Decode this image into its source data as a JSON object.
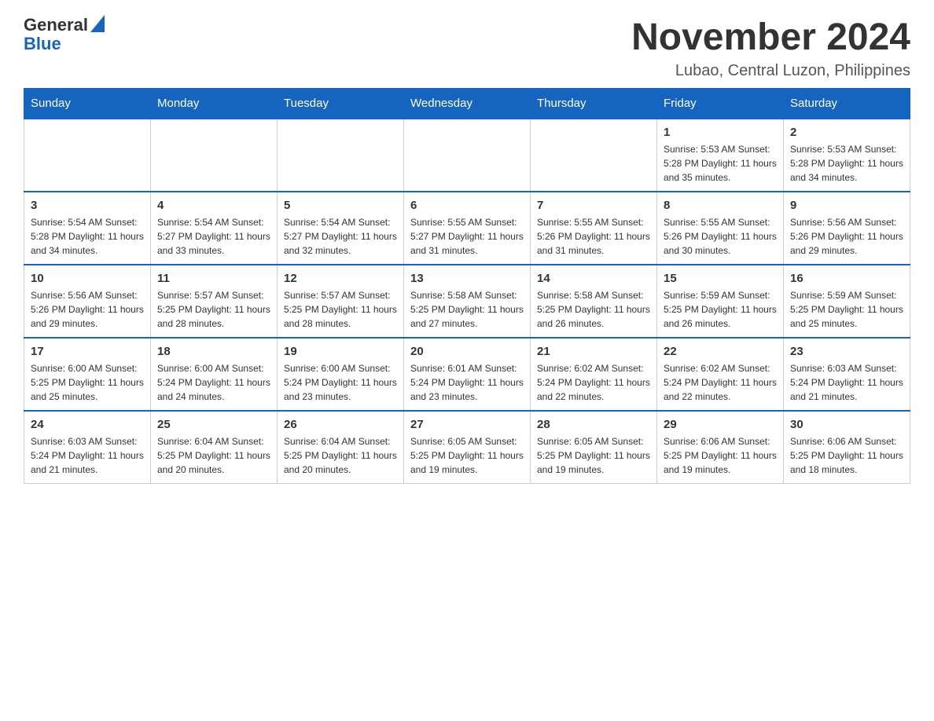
{
  "header": {
    "logo_general": "General",
    "logo_blue": "Blue",
    "title": "November 2024",
    "subtitle": "Lubao, Central Luzon, Philippines"
  },
  "calendar": {
    "days_of_week": [
      "Sunday",
      "Monday",
      "Tuesday",
      "Wednesday",
      "Thursday",
      "Friday",
      "Saturday"
    ],
    "weeks": [
      [
        {
          "day": "",
          "info": ""
        },
        {
          "day": "",
          "info": ""
        },
        {
          "day": "",
          "info": ""
        },
        {
          "day": "",
          "info": ""
        },
        {
          "day": "",
          "info": ""
        },
        {
          "day": "1",
          "info": "Sunrise: 5:53 AM\nSunset: 5:28 PM\nDaylight: 11 hours and 35 minutes."
        },
        {
          "day": "2",
          "info": "Sunrise: 5:53 AM\nSunset: 5:28 PM\nDaylight: 11 hours and 34 minutes."
        }
      ],
      [
        {
          "day": "3",
          "info": "Sunrise: 5:54 AM\nSunset: 5:28 PM\nDaylight: 11 hours and 34 minutes."
        },
        {
          "day": "4",
          "info": "Sunrise: 5:54 AM\nSunset: 5:27 PM\nDaylight: 11 hours and 33 minutes."
        },
        {
          "day": "5",
          "info": "Sunrise: 5:54 AM\nSunset: 5:27 PM\nDaylight: 11 hours and 32 minutes."
        },
        {
          "day": "6",
          "info": "Sunrise: 5:55 AM\nSunset: 5:27 PM\nDaylight: 11 hours and 31 minutes."
        },
        {
          "day": "7",
          "info": "Sunrise: 5:55 AM\nSunset: 5:26 PM\nDaylight: 11 hours and 31 minutes."
        },
        {
          "day": "8",
          "info": "Sunrise: 5:55 AM\nSunset: 5:26 PM\nDaylight: 11 hours and 30 minutes."
        },
        {
          "day": "9",
          "info": "Sunrise: 5:56 AM\nSunset: 5:26 PM\nDaylight: 11 hours and 29 minutes."
        }
      ],
      [
        {
          "day": "10",
          "info": "Sunrise: 5:56 AM\nSunset: 5:26 PM\nDaylight: 11 hours and 29 minutes."
        },
        {
          "day": "11",
          "info": "Sunrise: 5:57 AM\nSunset: 5:25 PM\nDaylight: 11 hours and 28 minutes."
        },
        {
          "day": "12",
          "info": "Sunrise: 5:57 AM\nSunset: 5:25 PM\nDaylight: 11 hours and 28 minutes."
        },
        {
          "day": "13",
          "info": "Sunrise: 5:58 AM\nSunset: 5:25 PM\nDaylight: 11 hours and 27 minutes."
        },
        {
          "day": "14",
          "info": "Sunrise: 5:58 AM\nSunset: 5:25 PM\nDaylight: 11 hours and 26 minutes."
        },
        {
          "day": "15",
          "info": "Sunrise: 5:59 AM\nSunset: 5:25 PM\nDaylight: 11 hours and 26 minutes."
        },
        {
          "day": "16",
          "info": "Sunrise: 5:59 AM\nSunset: 5:25 PM\nDaylight: 11 hours and 25 minutes."
        }
      ],
      [
        {
          "day": "17",
          "info": "Sunrise: 6:00 AM\nSunset: 5:25 PM\nDaylight: 11 hours and 25 minutes."
        },
        {
          "day": "18",
          "info": "Sunrise: 6:00 AM\nSunset: 5:24 PM\nDaylight: 11 hours and 24 minutes."
        },
        {
          "day": "19",
          "info": "Sunrise: 6:00 AM\nSunset: 5:24 PM\nDaylight: 11 hours and 23 minutes."
        },
        {
          "day": "20",
          "info": "Sunrise: 6:01 AM\nSunset: 5:24 PM\nDaylight: 11 hours and 23 minutes."
        },
        {
          "day": "21",
          "info": "Sunrise: 6:02 AM\nSunset: 5:24 PM\nDaylight: 11 hours and 22 minutes."
        },
        {
          "day": "22",
          "info": "Sunrise: 6:02 AM\nSunset: 5:24 PM\nDaylight: 11 hours and 22 minutes."
        },
        {
          "day": "23",
          "info": "Sunrise: 6:03 AM\nSunset: 5:24 PM\nDaylight: 11 hours and 21 minutes."
        }
      ],
      [
        {
          "day": "24",
          "info": "Sunrise: 6:03 AM\nSunset: 5:24 PM\nDaylight: 11 hours and 21 minutes."
        },
        {
          "day": "25",
          "info": "Sunrise: 6:04 AM\nSunset: 5:25 PM\nDaylight: 11 hours and 20 minutes."
        },
        {
          "day": "26",
          "info": "Sunrise: 6:04 AM\nSunset: 5:25 PM\nDaylight: 11 hours and 20 minutes."
        },
        {
          "day": "27",
          "info": "Sunrise: 6:05 AM\nSunset: 5:25 PM\nDaylight: 11 hours and 19 minutes."
        },
        {
          "day": "28",
          "info": "Sunrise: 6:05 AM\nSunset: 5:25 PM\nDaylight: 11 hours and 19 minutes."
        },
        {
          "day": "29",
          "info": "Sunrise: 6:06 AM\nSunset: 5:25 PM\nDaylight: 11 hours and 19 minutes."
        },
        {
          "day": "30",
          "info": "Sunrise: 6:06 AM\nSunset: 5:25 PM\nDaylight: 11 hours and 18 minutes."
        }
      ]
    ]
  }
}
